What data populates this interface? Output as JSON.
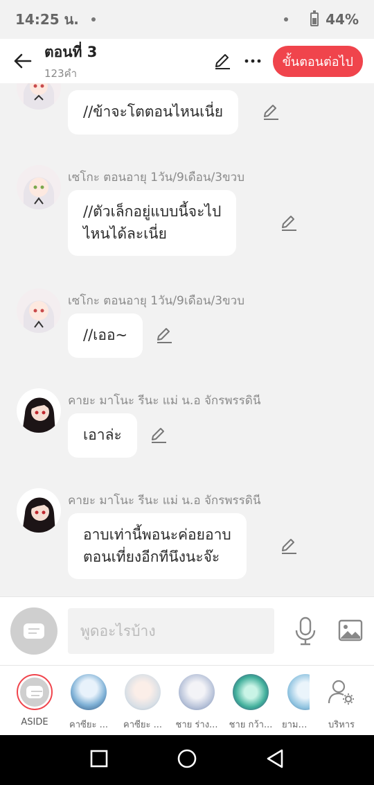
{
  "status": {
    "time": "14:25 น.",
    "battery": "44%"
  },
  "header": {
    "title": "ตอนที่ 3",
    "word_count": "123คำ",
    "next_button": "ขั้นตอนต่อไป"
  },
  "messages": [
    {
      "name": "",
      "text": "//ข้าจะโตตอนไหนเนี่ย"
    },
    {
      "name": "เซโกะ ตอนอายุ 1วัน/9เดือน/3ขวบ",
      "text": "//ตัวเล็กอยู่แบบนี้จะไป\nไหนได้ละเนี่ย"
    },
    {
      "name": "เซโกะ ตอนอายุ 1วัน/9เดือน/3ขวบ",
      "text": "//เออ~"
    },
    {
      "name": "คายะ มาโนะ รีนะ แม่ น.อ จักรพรรดินี",
      "text": "เอาล่ะ"
    },
    {
      "name": "คายะ มาโนะ รีนะ แม่ น.อ จักรพรรดินี",
      "text": "อาบเท่านี้พอนะค่อยอาบ\nตอนเที่ยงอีกทีนึงนะจ๊ะ"
    }
  ],
  "input": {
    "placeholder": "พูดอะไรบ้าง"
  },
  "characters": [
    {
      "label": "ASIDE"
    },
    {
      "label": "คาซียะ ..."
    },
    {
      "label": "คาซียะ ..."
    },
    {
      "label": "ชาย ร่าง..."
    },
    {
      "label": "ชาย กว้า..."
    },
    {
      "label": "ยามะ ..."
    },
    {
      "label": "บริหาร"
    }
  ],
  "colors": {
    "accent": "#f0444c",
    "background": "#f2f2f2"
  }
}
